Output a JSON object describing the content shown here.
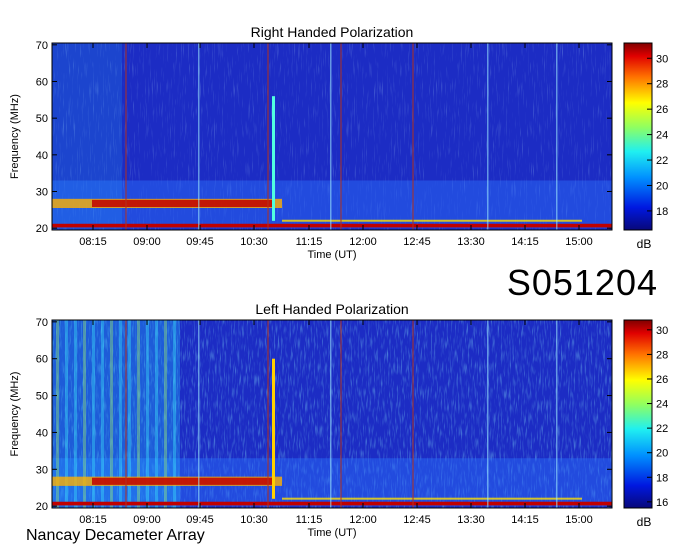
{
  "observation_code": "S051204",
  "instrument": "Nancay Decameter Array",
  "colors": {
    "background_blue": "#1f2fc8",
    "burst_red": "#b00000",
    "marker_line": "#a0302a",
    "colormap": [
      "#08087a",
      "#0030ff",
      "#00b0ff",
      "#40ffd0",
      "#c0ff40",
      "#ffd000",
      "#ff4000",
      "#8a0000"
    ]
  },
  "chart_data": [
    {
      "type": "heatmap",
      "title": "Right Handed Polarization",
      "xlabel": "Time (UT)",
      "ylabel": "Frequency (MHz)",
      "x_ticks": [
        "08:15",
        "09:00",
        "09:45",
        "10:30",
        "11:15",
        "12:00",
        "12:45",
        "13:30",
        "14:15",
        "15:00"
      ],
      "y_ticks": [
        20,
        30,
        40,
        50,
        60,
        70
      ],
      "ylim": [
        19.5,
        70.5
      ],
      "colorbar": {
        "label": "dB",
        "ticks": [
          18,
          20,
          22,
          24,
          26,
          28,
          30
        ],
        "range": [
          16.5,
          31.2
        ]
      }
    },
    {
      "type": "heatmap",
      "title": "Left Handed Polarization",
      "xlabel": "Time (UT)",
      "ylabel": "Frequency (MHz)",
      "x_ticks": [
        "08:15",
        "09:00",
        "09:45",
        "10:30",
        "11:15",
        "12:00",
        "12:45",
        "13:30",
        "14:15",
        "15:00"
      ],
      "y_ticks": [
        20,
        30,
        40,
        50,
        60,
        70
      ],
      "ylim": [
        19.5,
        70.5
      ],
      "colorbar": {
        "label": "dB",
        "ticks": [
          16,
          18,
          20,
          22,
          24,
          26,
          28,
          30
        ],
        "range": [
          15.5,
          30.8
        ]
      }
    }
  ]
}
